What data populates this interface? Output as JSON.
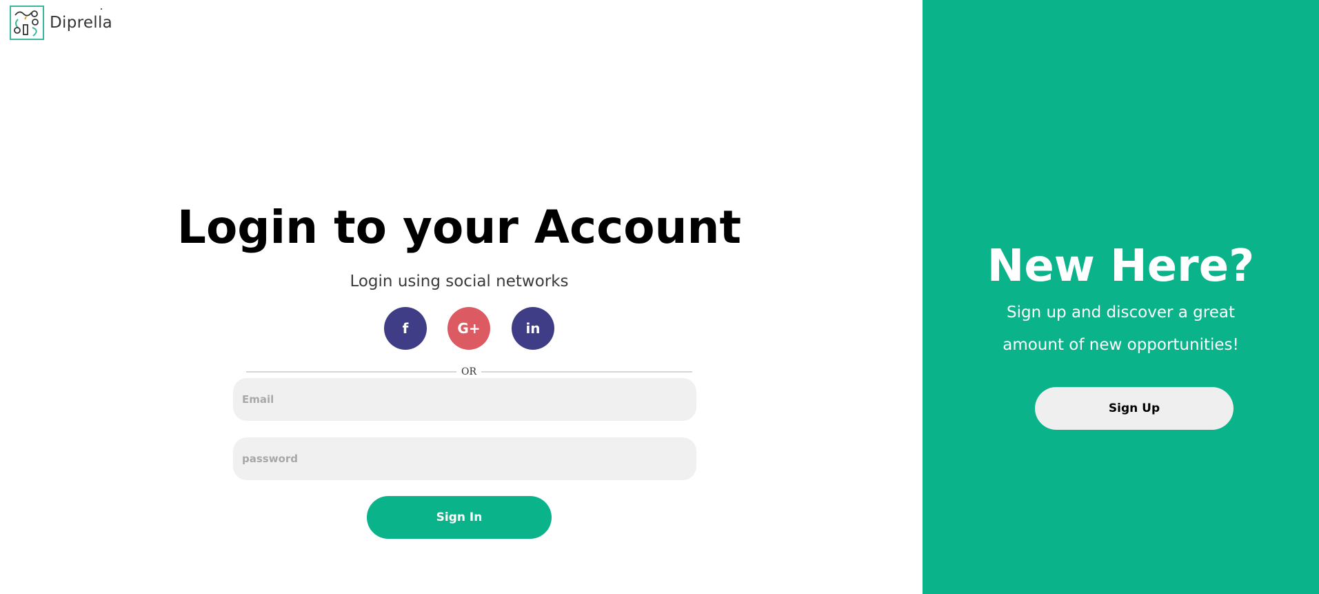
{
  "brand": {
    "name": "Diprella",
    "logo_icon": "diprella-logo-icon",
    "accent_color": "#0bb38b"
  },
  "login": {
    "title": "Login to your Account",
    "subtitle": "Login using social networks",
    "social": [
      {
        "label": "f",
        "icon": "facebook-icon",
        "color": "#3f3d85"
      },
      {
        "label": "G+",
        "icon": "google-plus-icon",
        "color": "#dc5a62"
      },
      {
        "label": "in",
        "icon": "linkedin-icon",
        "color": "#3f3d85"
      }
    ],
    "divider_text": "OR",
    "email": {
      "placeholder": "Email",
      "value": ""
    },
    "password": {
      "placeholder": "password",
      "value": ""
    },
    "signin_label": "Sign In"
  },
  "signup_panel": {
    "title": "New Here?",
    "text": "Sign up and discover a great amount of new opportunities!",
    "signup_label": "Sign Up",
    "background_color": "#0bb38b"
  }
}
